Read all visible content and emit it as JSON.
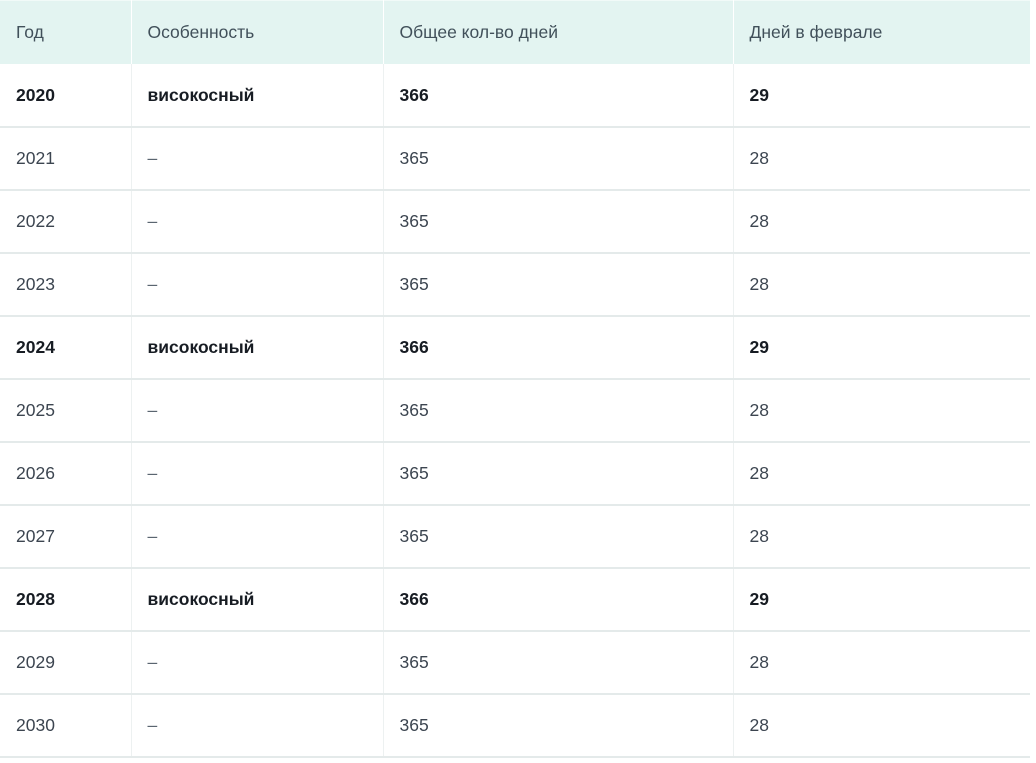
{
  "table": {
    "name": "leap-years-table",
    "columns": [
      {
        "key": "year",
        "label": "Год"
      },
      {
        "key": "feature",
        "label": "Особенность"
      },
      {
        "key": "total",
        "label": "Общее кол-во дней"
      },
      {
        "key": "feb",
        "label": "Дней в феврале"
      }
    ],
    "rows": [
      {
        "year": "2020",
        "feature": "високосный",
        "total": "366",
        "feb": "29",
        "leap": true
      },
      {
        "year": "2021",
        "feature": "–",
        "total": "365",
        "feb": "28",
        "leap": false
      },
      {
        "year": "2022",
        "feature": "–",
        "total": "365",
        "feb": "28",
        "leap": false
      },
      {
        "year": "2023",
        "feature": "–",
        "total": "365",
        "feb": "28",
        "leap": false
      },
      {
        "year": "2024",
        "feature": "високосный",
        "total": "366",
        "feb": "29",
        "leap": true
      },
      {
        "year": "2025",
        "feature": "–",
        "total": "365",
        "feb": "28",
        "leap": false
      },
      {
        "year": "2026",
        "feature": "–",
        "total": "365",
        "feb": "28",
        "leap": false
      },
      {
        "year": "2027",
        "feature": "–",
        "total": "365",
        "feb": "28",
        "leap": false
      },
      {
        "year": "2028",
        "feature": "високосный",
        "total": "366",
        "feb": "29",
        "leap": true
      },
      {
        "year": "2029",
        "feature": "–",
        "total": "365",
        "feb": "28",
        "leap": false
      },
      {
        "year": "2030",
        "feature": "–",
        "total": "365",
        "feb": "28",
        "leap": false
      }
    ]
  },
  "colors": {
    "header_background": "#e3f4f1",
    "header_text": "#41505a",
    "body_text": "#3c4550",
    "leap_text": "#171c23",
    "row_divider": "#e4eaea",
    "column_divider": "#edf1f1",
    "page_background": "#ffffff"
  }
}
